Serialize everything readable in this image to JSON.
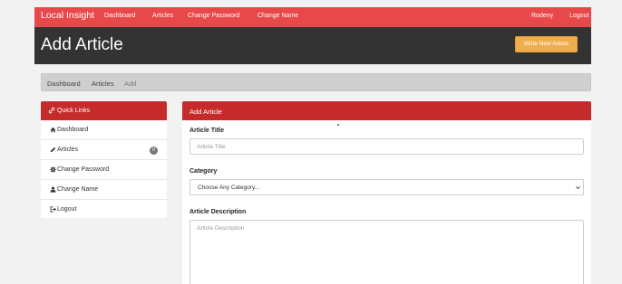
{
  "navbar": {
    "brand": "Local Insight",
    "links": [
      "Dashboard",
      "Articles",
      "Change Password",
      "Change Name"
    ],
    "user": "Rodeny",
    "logout": "Logout"
  },
  "header": {
    "title": "Add Article",
    "write_button": "Write New Article"
  },
  "breadcrumb": [
    "Dashboard",
    "Articles",
    "Add"
  ],
  "sidebar": {
    "title": "Quick Links",
    "items": [
      {
        "label": "Dashboard",
        "icon": "home-icon"
      },
      {
        "label": "Articles",
        "icon": "pencil-icon",
        "badge": "0"
      },
      {
        "label": "Change Password",
        "icon": "gear-icon"
      },
      {
        "label": "Change Name",
        "icon": "user-icon"
      },
      {
        "label": "Logout",
        "icon": "logout-icon"
      }
    ]
  },
  "form": {
    "panel_title": "Add Article",
    "title_label": "Article Title",
    "title_placeholder": "Article Title",
    "category_label": "Category",
    "category_value": "Choose Any Category...",
    "description_label": "Article Description",
    "description_placeholder": "Article Description"
  },
  "colors": {
    "navbar": "#e84849",
    "header": "#333333",
    "panel_header": "#c62b2b",
    "write_button": "#f0ad4e",
    "breadcrumb": "#cfcfcf"
  }
}
